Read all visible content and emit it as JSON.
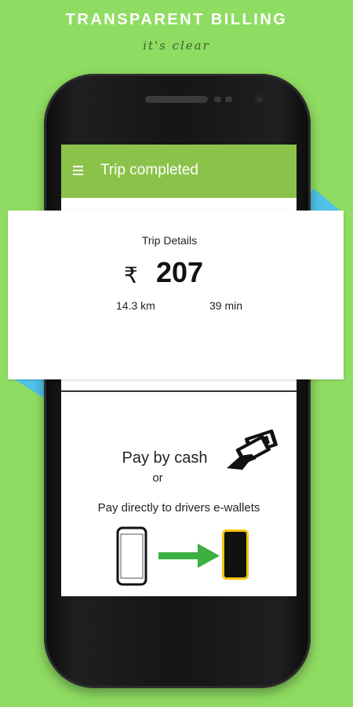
{
  "banner": {
    "headline": "TRANSPARENT BILLING",
    "tagline": "it's clear"
  },
  "app": {
    "title": "Trip completed",
    "menu_icon": "hamburger-menu-icon",
    "bar_color": "#8bc34a"
  },
  "trip": {
    "heading": "Trip Details",
    "currency_symbol": "₹",
    "amount": "207",
    "distance": "14.3 km",
    "duration": "39 min"
  },
  "payment": {
    "cash_label": "Pay by cash",
    "or_label": "or",
    "ewallet_label": "Pay directly to drivers e-wallets",
    "cash_icon": "cash-payment-icon",
    "transfer_icon": "phone-to-phone-transfer-icon"
  },
  "colors": {
    "background": "#8fdc62",
    "accent_teal": "#4fc3e8",
    "arrow_green": "#3cb043",
    "wallet_yellow": "#f6c40f"
  }
}
